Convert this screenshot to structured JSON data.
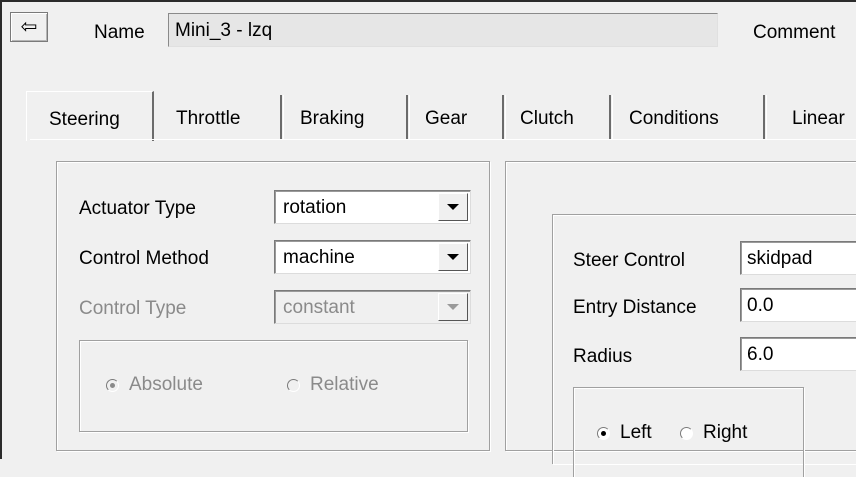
{
  "header": {
    "back_icon": "back-arrow-icon",
    "back_glyph": "⇦",
    "name_label": "Name",
    "name_value": "Mini_3 - lzq",
    "comment_label": "Comment"
  },
  "tabs": [
    {
      "label": "Steering",
      "active": true
    },
    {
      "label": "Throttle"
    },
    {
      "label": "Braking"
    },
    {
      "label": "Gear"
    },
    {
      "label": "Clutch"
    },
    {
      "label": "Conditions"
    },
    {
      "label": "Linear"
    }
  ],
  "steering": {
    "actuator_type": {
      "label": "Actuator Type",
      "value": "rotation"
    },
    "control_method": {
      "label": "Control Method",
      "value": "machine"
    },
    "control_type": {
      "label": "Control Type",
      "value": "constant",
      "disabled": true
    },
    "reference": {
      "options": [
        "Absolute",
        "Relative"
      ],
      "selected": "Absolute",
      "disabled": true
    }
  },
  "skidpad": {
    "steer_control": {
      "label": "Steer Control",
      "value": "skidpad"
    },
    "entry_distance": {
      "label": "Entry Distance",
      "value": "0.0"
    },
    "radius": {
      "label": "Radius",
      "value": "6.0"
    },
    "direction": {
      "options": [
        "Left",
        "Right"
      ],
      "selected": "Left"
    }
  }
}
